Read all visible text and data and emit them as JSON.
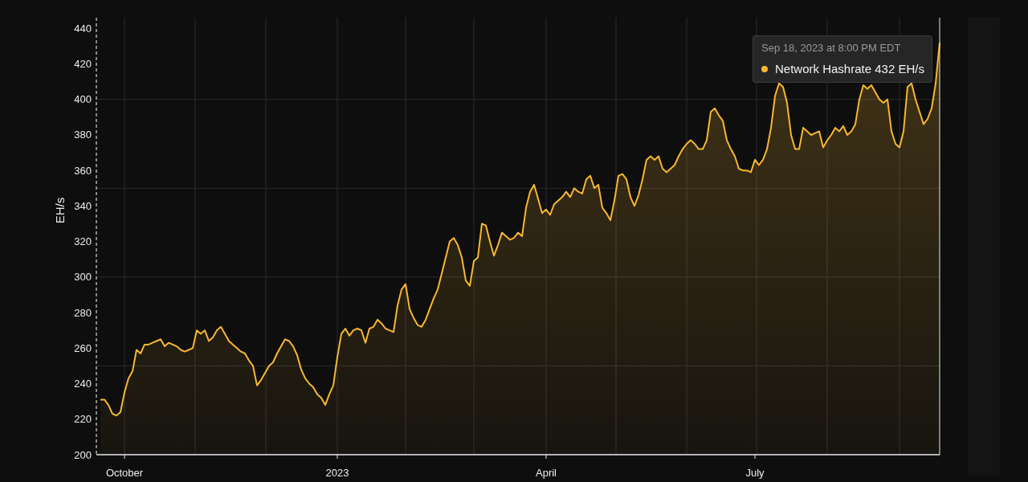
{
  "chart": {
    "chart_data": {
      "type": "area",
      "ylabel": "EH/s",
      "ylim": [
        200,
        446
      ],
      "yticks": [
        200,
        220,
        240,
        260,
        280,
        300,
        320,
        340,
        360,
        380,
        400,
        420,
        440
      ],
      "categories": [
        null,
        null,
        null,
        null,
        null,
        null,
        "October",
        null,
        null,
        null,
        null,
        null,
        null,
        null,
        null,
        null,
        null,
        null,
        null,
        null,
        null,
        null,
        null,
        null,
        null,
        null,
        null,
        null,
        null,
        null,
        null,
        null,
        null,
        null,
        null,
        null,
        null,
        null,
        null,
        null,
        null,
        null,
        null,
        null,
        null,
        null,
        null,
        null,
        null,
        null,
        null,
        null,
        null,
        null,
        null,
        null,
        null,
        null,
        null,
        "2023",
        null,
        null,
        null,
        null,
        null,
        null,
        null,
        null,
        null,
        null,
        null,
        null,
        null,
        null,
        null,
        null,
        null,
        null,
        null,
        null,
        null,
        null,
        null,
        null,
        null,
        null,
        null,
        null,
        null,
        null,
        null,
        null,
        null,
        null,
        null,
        null,
        null,
        null,
        null,
        null,
        null,
        null,
        null,
        null,
        null,
        null,
        null,
        null,
        null,
        null,
        null,
        "April",
        null,
        null,
        null,
        null,
        null,
        null,
        null,
        null,
        null,
        null,
        null,
        null,
        null,
        null,
        null,
        null,
        null,
        null,
        null,
        null,
        null,
        null,
        null,
        null,
        null,
        null,
        null,
        null,
        null,
        null,
        null,
        null,
        null,
        null,
        null,
        null,
        null,
        null,
        null,
        null,
        null,
        null,
        null,
        null,
        null,
        null,
        null,
        null,
        null,
        null,
        null,
        "July",
        null,
        null,
        null,
        null,
        null,
        null,
        null,
        null,
        null,
        null,
        null,
        null,
        null,
        null,
        null,
        null,
        null,
        null,
        null,
        null,
        null,
        null,
        null,
        null,
        null,
        null,
        null,
        null,
        null,
        null,
        null,
        null,
        null,
        null,
        null,
        null,
        null,
        null,
        null,
        null,
        null,
        null,
        null,
        null,
        null,
        null
      ],
      "series": [
        {
          "name": "Network Hashrate",
          "color": "#f7b731",
          "values": [
            231,
            231,
            228,
            223,
            222,
            224,
            235,
            243,
            247,
            259,
            257,
            262,
            262,
            263,
            264,
            265,
            261,
            263,
            262,
            261,
            259,
            258,
            259,
            260,
            270,
            268,
            270,
            264,
            266,
            270,
            272,
            268,
            264,
            262,
            260,
            258,
            257,
            253,
            250,
            239,
            242,
            246,
            250,
            252,
            257,
            261,
            265,
            264,
            261,
            256,
            248,
            243,
            240,
            238,
            234,
            232,
            228,
            234,
            239,
            255,
            268,
            271,
            267,
            270,
            271,
            270,
            263,
            271,
            272,
            276,
            274,
            271,
            270,
            269,
            284,
            293,
            296,
            282,
            277,
            273,
            272,
            276,
            282,
            288,
            293,
            302,
            311,
            320,
            322,
            318,
            311,
            298,
            295,
            309,
            311,
            330,
            329,
            320,
            312,
            318,
            325,
            323,
            321,
            322,
            325,
            323,
            339,
            348,
            352,
            344,
            336,
            338,
            335,
            341,
            343,
            345,
            348,
            345,
            350,
            348,
            347,
            355,
            357,
            350,
            352,
            339,
            336,
            332,
            343,
            357,
            358,
            355,
            345,
            340,
            346,
            355,
            366,
            368,
            366,
            368,
            361,
            359,
            361,
            363,
            368,
            372,
            375,
            377,
            375,
            372,
            372,
            377,
            393,
            395,
            391,
            388,
            377,
            372,
            368,
            361,
            360,
            360,
            359,
            366,
            363,
            366,
            372,
            384,
            402,
            409,
            407,
            398,
            380,
            372,
            372,
            384,
            382,
            380,
            381,
            382,
            373,
            377,
            380,
            384,
            382,
            385,
            380,
            382,
            386,
            400,
            408,
            406,
            408,
            404,
            400,
            398,
            400,
            382,
            375,
            373,
            382,
            407,
            409,
            400,
            393,
            386,
            389,
            395,
            409,
            432
          ]
        }
      ]
    }
  },
  "tooltip": {
    "timestamp": "Sep 18, 2023 at 8:00 PM EDT",
    "value": "432 EH/s"
  }
}
